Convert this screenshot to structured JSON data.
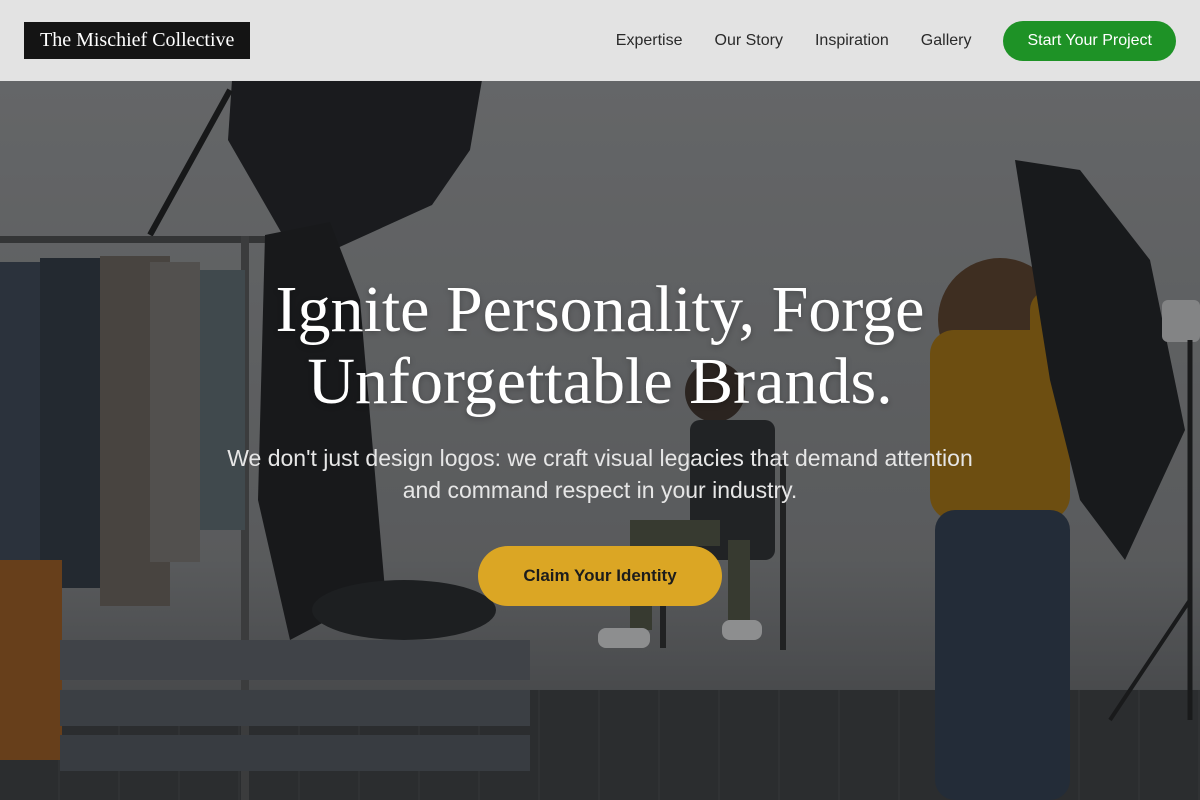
{
  "brand": {
    "name": "The Mischief Collective"
  },
  "nav": {
    "links": [
      {
        "label": "Expertise"
      },
      {
        "label": "Our Story"
      },
      {
        "label": "Inspiration"
      },
      {
        "label": "Gallery"
      }
    ],
    "cta_label": "Start Your Project"
  },
  "hero": {
    "title_line1": "Ignite Personality, Forge",
    "title_line2": "Unforgettable Brands.",
    "subtitle": "We don't just design logos: we craft visual legacies that demand attention and command respect in your industry.",
    "cta_label": "Claim Your Identity",
    "background_description_icon": "photo-studio-image"
  },
  "colors": {
    "nav_cta_bg": "#1e9226",
    "hero_cta_bg": "#dba624",
    "brand_bg": "#141414",
    "navbar_bg": "#e8e8e8"
  }
}
